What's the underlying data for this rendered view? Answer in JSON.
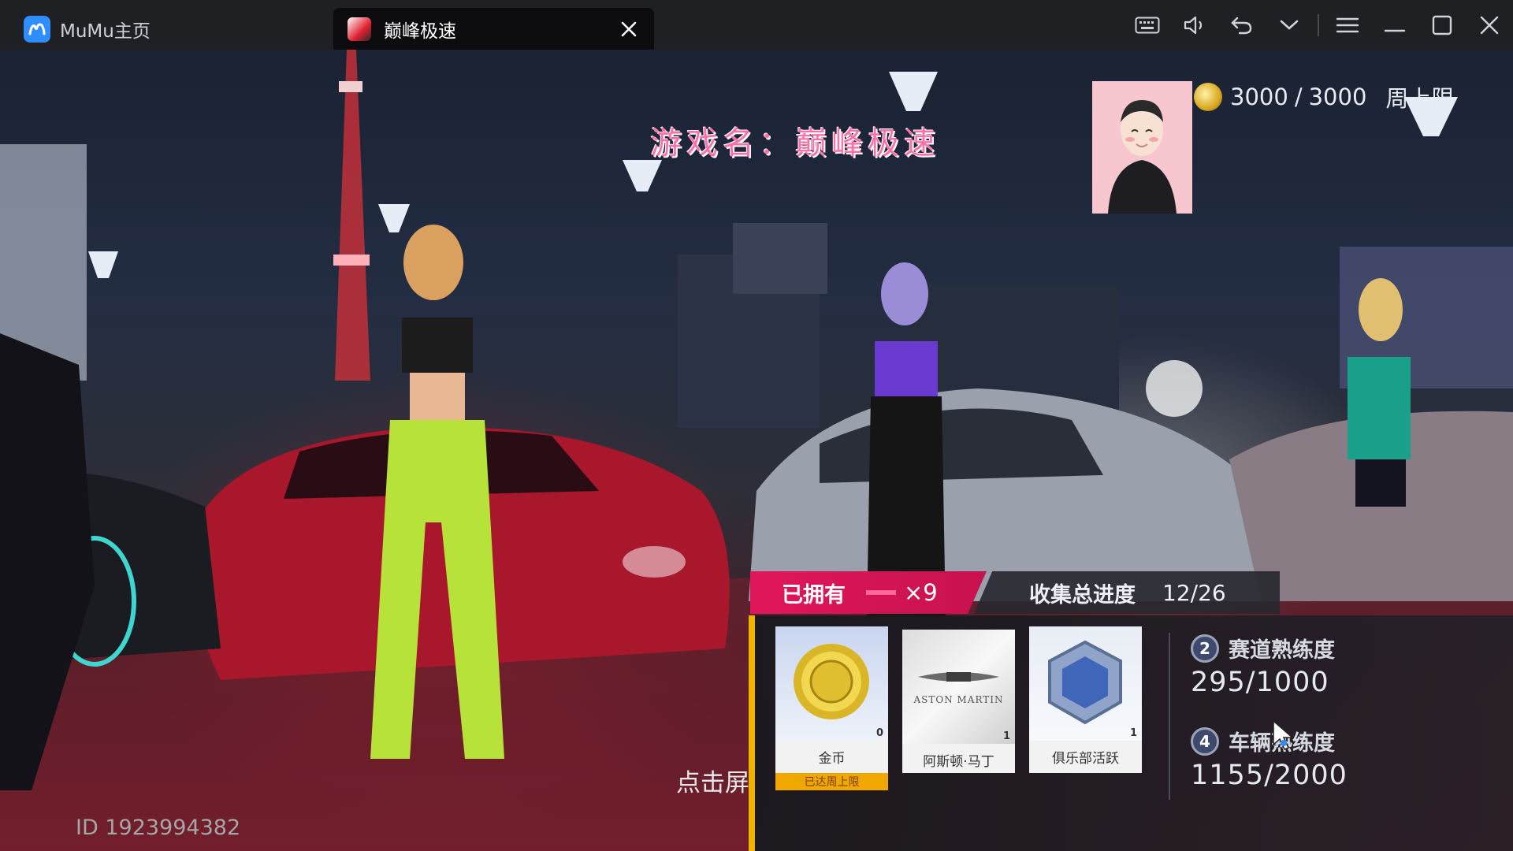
{
  "window": {
    "home_tab": "MuMu主页",
    "active_tab": "巅峰极速",
    "toolbar_icons": [
      "keyboard-icon",
      "volume-icon",
      "undo-icon",
      "chevron-down-icon",
      "menu-icon",
      "minimize-icon",
      "maximize-icon",
      "close-icon"
    ]
  },
  "game": {
    "name_banner": "游戏名：巅峰极速",
    "currency": {
      "current": "3000",
      "separator": "/",
      "max": "3000",
      "cap_label": "周上限"
    },
    "player_id": "ID 1923994382",
    "tap_hint": "点击屏"
  },
  "collection": {
    "owned_label": "已拥有",
    "owned_count": "×9",
    "progress_label": "收集总进度",
    "progress_value": "12/26",
    "rewards": [
      {
        "name": "金币",
        "qty": "0",
        "tag": "已达周上限"
      },
      {
        "name": "阿斯顿·马丁",
        "qty": "1",
        "brand_text": "ASTON MARTIN"
      },
      {
        "name": "俱乐部活跃",
        "qty": "1"
      }
    ],
    "stats": [
      {
        "badge": "2",
        "label": "赛道熟练度",
        "value": "295/1000"
      },
      {
        "badge": "4",
        "label": "车辆熟练度",
        "label_visible": "车辆",
        "value": "1155/2000"
      }
    ]
  },
  "colors": {
    "titlebar": "#1f2024",
    "accent_pink": "#e0165a",
    "accent_gold": "#f0b400",
    "banner_pink": "#ff6fa8"
  }
}
